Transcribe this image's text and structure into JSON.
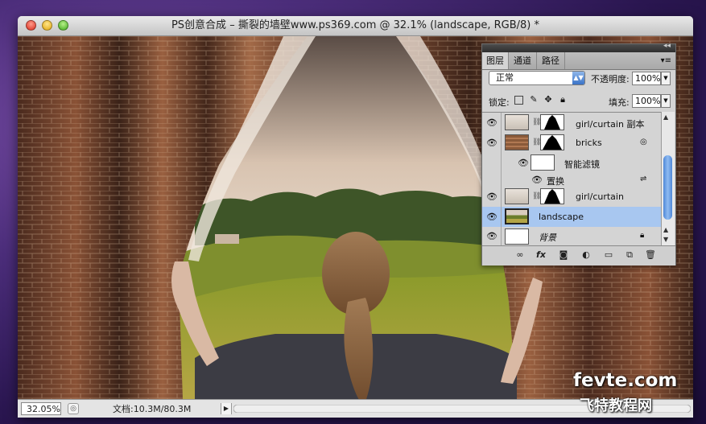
{
  "window": {
    "title": "PS创意合成 – 撕裂的墙壁www.ps369.com @ 32.1% (landscape, RGB/8) *"
  },
  "statusbar": {
    "zoom": "32.05%",
    "doc_info": "文档:10.3M/80.3M"
  },
  "layers_panel": {
    "tabs": [
      "图层",
      "通道",
      "路径"
    ],
    "blend_mode": "正常",
    "opacity_label": "不透明度:",
    "opacity_value": "100%",
    "lock_label": "锁定:",
    "fill_label": "填充:",
    "fill_value": "100%",
    "layers": [
      {
        "name": "girl/curtain 副本"
      },
      {
        "name": "bricks"
      },
      {
        "name": "智能滤镜"
      },
      {
        "name": "置换"
      },
      {
        "name": "girl/curtain"
      },
      {
        "name": "landscape",
        "selected": true
      },
      {
        "name": "背景"
      }
    ]
  },
  "watermark": {
    "line1": "fevte.com",
    "line2": "飞特教程网"
  }
}
